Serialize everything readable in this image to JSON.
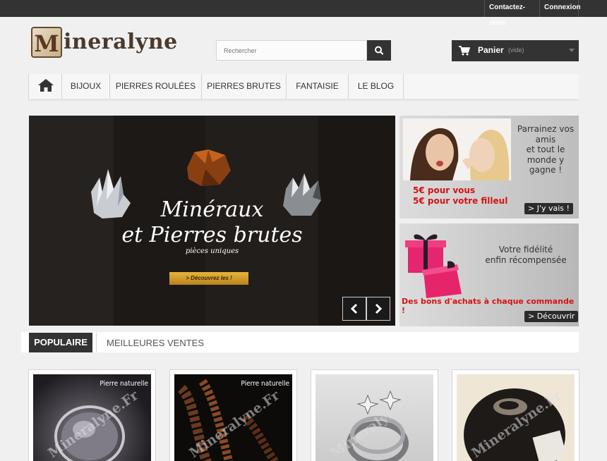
{
  "topbar": {
    "contact": "Contactez-nous",
    "login": "Connexion"
  },
  "logo": {
    "initial": "M",
    "text": "ineralyne"
  },
  "search": {
    "placeholder": "Rechercher"
  },
  "cart": {
    "label": "Panier",
    "status": "(vide)"
  },
  "menu": {
    "items": [
      "BIJOUX",
      "PIERRES ROULÉES",
      "PIERRES BRUTES",
      "FANTAISIE",
      "LE BLOG"
    ]
  },
  "slider": {
    "line1": "Minéraux",
    "line2": "et Pierres brutes",
    "line3": "pièces uniques",
    "cta": "> Découvrez les !"
  },
  "promo1": {
    "text": [
      "Parrainez vos",
      "amis",
      "et tout le",
      "monde y",
      "gagne !"
    ],
    "red": [
      "5€ pour vous",
      "5€ pour votre filleul"
    ],
    "button": "> J'y vais !"
  },
  "promo2": {
    "text": [
      "Votre fidélité",
      "enfin récompensée"
    ],
    "red": "Des bons d'achats à chaque commande !",
    "button": "> Découvrir"
  },
  "tabs": {
    "popular": "POPULAIRE",
    "best": "MEILLEURES VENTES"
  },
  "products": [
    {
      "badge": "Pierre naturelle",
      "watermark": "Mineralyne.Fr"
    },
    {
      "badge": "Pierre naturelle",
      "watermark": "Mineralyne.Fr"
    },
    {
      "badge": "",
      "watermark": "Mineralyne.Fr"
    },
    {
      "badge": "",
      "watermark": "Mineralyne.Fr"
    }
  ],
  "colors": {
    "dark": "#333333",
    "red": "#d61313",
    "gold": "#d9a12c"
  }
}
